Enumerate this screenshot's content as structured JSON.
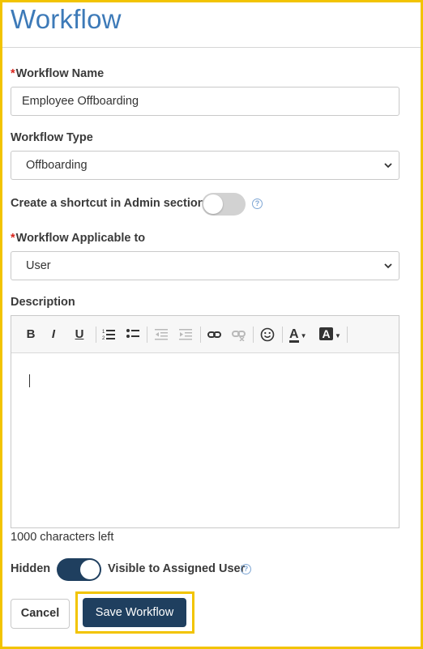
{
  "page": {
    "title": "Workflow"
  },
  "form": {
    "name_label": "Workflow Name",
    "name_value": "Employee Offboarding",
    "type_label": "Workflow Type",
    "type_value": "Offboarding",
    "shortcut_label": "Create a shortcut in Admin section",
    "shortcut_enabled": false,
    "applicable_label": "Workflow Applicable to",
    "applicable_value": "User",
    "description_label": "Description",
    "chars_left": "1000 characters left",
    "visibility_left": "Hidden",
    "visibility_right": "Visible to Assigned User",
    "visibility_enabled": true,
    "required_mark": "*",
    "help_mark": "?"
  },
  "toolbar": {
    "bold": "B",
    "italic": "I",
    "underline": "U",
    "ordered_list_icon": "ordered-list-icon",
    "bullet_list_icon": "bullet-list-icon",
    "outdent_icon": "outdent-icon",
    "indent_icon": "indent-icon",
    "link_icon": "link-icon",
    "unlink_icon": "unlink-icon",
    "emoji_icon": "emoji-icon",
    "text_color": "A",
    "bg_color": "A"
  },
  "buttons": {
    "cancel": "Cancel",
    "save": "Save Workflow"
  },
  "colors": {
    "accent": "#1f3f5f",
    "title": "#3d7ab8",
    "highlight": "#f2c400",
    "required": "#d9251d"
  }
}
